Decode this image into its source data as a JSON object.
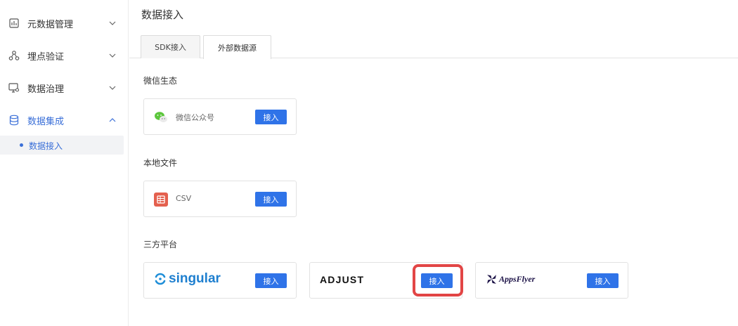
{
  "sidebar": {
    "items": [
      {
        "label": "元数据管理",
        "icon": "bar-chart-doc-icon"
      },
      {
        "label": "埋点验证",
        "icon": "tracking-nodes-icon"
      },
      {
        "label": "数据治理",
        "icon": "monitor-gear-icon"
      },
      {
        "label": "数据集成",
        "icon": "database-icon"
      }
    ],
    "sub_item": {
      "label": "数据接入"
    }
  },
  "page": {
    "title": "数据接入"
  },
  "tabs": [
    {
      "label": "SDK接入"
    },
    {
      "label": "外部数据源"
    }
  ],
  "sections": {
    "wechat": {
      "title": "微信生态",
      "cards": [
        {
          "name": "微信公众号",
          "button": "接入",
          "icon": "wechat-icon"
        }
      ]
    },
    "local": {
      "title": "本地文件",
      "cards": [
        {
          "name": "CSV",
          "button": "接入",
          "icon": "csv-file-icon"
        }
      ]
    },
    "third": {
      "title": "三方平台",
      "cards": [
        {
          "name": "singular",
          "button": "接入",
          "icon": "singular-logo"
        },
        {
          "name": "ADJUST",
          "button": "接入",
          "icon": "adjust-logo"
        },
        {
          "name": "AppsFlyer",
          "button": "接入",
          "icon": "appsflyer-logo"
        }
      ]
    }
  },
  "colors": {
    "accent": "#2f73e8",
    "highlight": "#e24545",
    "active_nav": "#3a6fd8"
  }
}
